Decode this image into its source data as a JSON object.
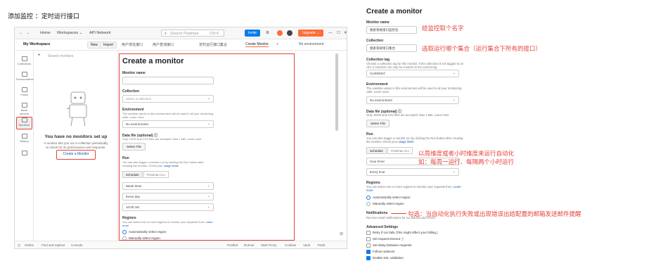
{
  "caption": "添加监控 ：定时运行接口",
  "screenshot": {
    "topbar": {
      "nav": "Home",
      "workspaces": "Workspaces ⌄",
      "api_network": "API Network",
      "search_placeholder": "Search Postman",
      "search_shortcut": "Ctrl K",
      "invite": "Invite",
      "upgrade": "Upgrade ⌄"
    },
    "workspace": {
      "name": "My Workspace",
      "new": "New",
      "import": "Import"
    },
    "tabs": [
      "用户地址接口",
      "用户查询接口",
      "定时运行接口集合",
      "Create Monitor"
    ],
    "environment": "No environment",
    "sidebar": [
      "Collections",
      "Environments",
      "Flows",
      "Mock servers",
      "Monitors",
      "History"
    ],
    "monitor_list": {
      "search_placeholder": "Search monitors",
      "empty_title": "You have no monitors set up",
      "empty_desc": "A monitor lets you run a collection periodically to check for its performance and response.",
      "create_button": "Create a Monitor"
    },
    "form": {
      "title": "Create a monitor",
      "monitor_name_label": "Monitor name",
      "collection_label": "Collection",
      "collection_placeholder": "Select a collection",
      "environment_label": "Environment",
      "environment_help": "The variable values in this environment will be used in all your monitoring calls. Learn more",
      "environment_value": "No environment",
      "datafile_label": "Data file (optional) ⓘ",
      "datafile_help": "Only JSON and CSV files are accepted. Max 1 MB. Learn more",
      "select_file": "Select File",
      "run_label": "Run",
      "run_help": "You can also trigger a monitor run by clicking the Run button after creating the monitor. Check your ",
      "run_help_link": "usage limits",
      "schedule_tab": "Schedule",
      "postman_cli_tab": "Postman CLI",
      "timer": "Week timer",
      "every": "Every day",
      "time": "10:00 AM",
      "regions_label": "Regions",
      "regions_help": "You can select one or more regions to monitor your requests from.",
      "regions_link": "Learn more",
      "auto_region": "Automatically select region",
      "manual_region": "Manually select region"
    },
    "statusbar": {
      "online": "Online",
      "find_replace": "Find and replace",
      "console": "Console",
      "postbot": "Postbot",
      "runner": "Runner",
      "start_proxy": "Start Proxy",
      "cookies": "Cookies",
      "vault": "Vault",
      "trash": "Trash"
    }
  },
  "right_panel": {
    "title": "Create a monitor",
    "monitor_name_label": "Monitor name",
    "monitor_name_value": "搜索系统接口监控化",
    "collection_label": "Collection",
    "collection_value": "搜索系统接口集合",
    "collection_tag_label": "Collection tag",
    "collection_tag_help": "Choose a collection tag for this monitor. If the collection is not tagged to an API, it monitors can only be created on the current tag.",
    "collection_tag_value": "CURRENT",
    "environment_label": "Environment",
    "environment_help": "The variable values in this environment will be used in all your monitoring calls. Learn more",
    "environment_value": "No environment",
    "datafile_label": "Data file (optional) ⓘ",
    "datafile_help": "Only JSON and CSV files are accepted. Max 1 MB. Learn more",
    "select_file": "Select File",
    "run_label": "Run",
    "run_help": "You can also trigger a monitor run by clicking the Run button after creating the monitor. Check your ",
    "run_help_link": "usage limits",
    "schedule_tab": "Schedule",
    "postman_cli_tab": "Postman CLI",
    "timer": "Hour timer",
    "every": "Every hour",
    "regions_label": "Regions",
    "regions_help": "You can select one or more regions to monitor your requests from.",
    "regions_link": "Learn more",
    "auto_region": "Automatically select region",
    "manual_region": "Manually select region",
    "notifications_label": "Notifications",
    "notifications_help": "Receive email notifications for run failures and errors",
    "advanced_label": "Advanced Settings",
    "advanced": [
      {
        "label": "Retry if run fails (This might affect your billing.)",
        "checked": false
      },
      {
        "label": "Set request timeout ⓘ",
        "checked": false
      },
      {
        "label": "Set delay between requests",
        "checked": false
      },
      {
        "label": "Follow redirects",
        "checked": true
      },
      {
        "label": "Enable SSL validation",
        "checked": true
      }
    ],
    "annotations": {
      "name": "给监控取个名字",
      "collection": "选取运行哪个集合（运行集合下所有的接口）",
      "schedule_line1": "以周维度或者小时维度来运行自动化",
      "schedule_line2": "如：每周一运行、每隔两个小时运行",
      "notify": "勾选：当自动化执行失败或出现错误出给配置的邮箱发送邮件提醒"
    }
  },
  "colors": {
    "accent": "#e8423a",
    "link": "#0b57b8",
    "brand": "#ff6c37",
    "primary": "#097bed"
  }
}
